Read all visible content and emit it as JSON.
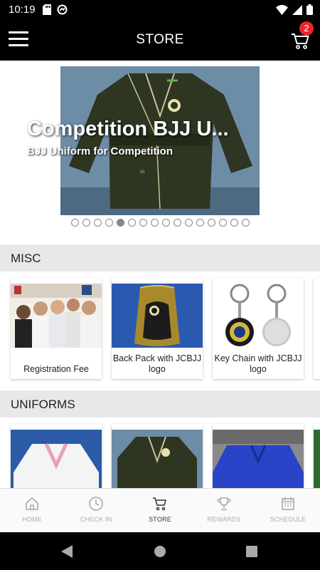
{
  "status_bar": {
    "time": "10:19"
  },
  "app_bar": {
    "title": "STORE",
    "cart_count": "2"
  },
  "carousel": {
    "title": "Competition BJJ U...",
    "subtitle": "BJJ Uniform for Competition",
    "dot_count": 16,
    "active_dot": 4
  },
  "sections": [
    {
      "title": "MISC",
      "items": [
        {
          "label": "Registration Fee"
        },
        {
          "label": "Back Pack with JCBJJ logo"
        },
        {
          "label": "Key Chain with JCBJJ logo"
        }
      ]
    },
    {
      "title": "UNIFORMS",
      "items": [
        {
          "label": ""
        },
        {
          "label": ""
        },
        {
          "label": ""
        }
      ]
    }
  ],
  "bottom_nav": [
    {
      "label": "HOME",
      "icon": "home-icon",
      "active": false
    },
    {
      "label": "CHECK IN",
      "icon": "clock-icon",
      "active": false
    },
    {
      "label": "STORE",
      "icon": "cart-icon",
      "active": true
    },
    {
      "label": "REWARDS",
      "icon": "trophy-icon",
      "active": false
    },
    {
      "label": "SCHEDULE",
      "icon": "calendar-icon",
      "active": false
    }
  ],
  "colors": {
    "badge": "#e8262a",
    "section_bg": "#e8e8e8",
    "app_bar": "#000000"
  }
}
